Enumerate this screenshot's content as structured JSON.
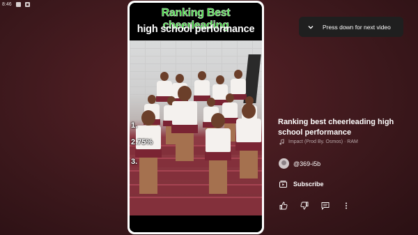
{
  "status_bar": {
    "time": "8:46"
  },
  "video": {
    "overlay_title_line1": "Ranking Best cheerleading",
    "overlay_title_line2": "high school performance",
    "ranks": [
      "1.",
      "2.75%",
      "3."
    ]
  },
  "toast": {
    "label": "Press down for next video",
    "icon": "chevron-down-icon"
  },
  "details": {
    "title": "Ranking best cheerleading high school performance",
    "music": "Impact (Prod By. Osmos) · RAM",
    "channel": "@369-i5b",
    "subscribe_label": "Subscribe"
  },
  "colors": {
    "background": "#3f1a1e",
    "overlay_green": "#3cd93a",
    "uniform_maroon": "#7a2433"
  },
  "actions": [
    "thumbs-up-icon",
    "thumbs-down-icon",
    "comment-icon",
    "more-vert-icon"
  ]
}
